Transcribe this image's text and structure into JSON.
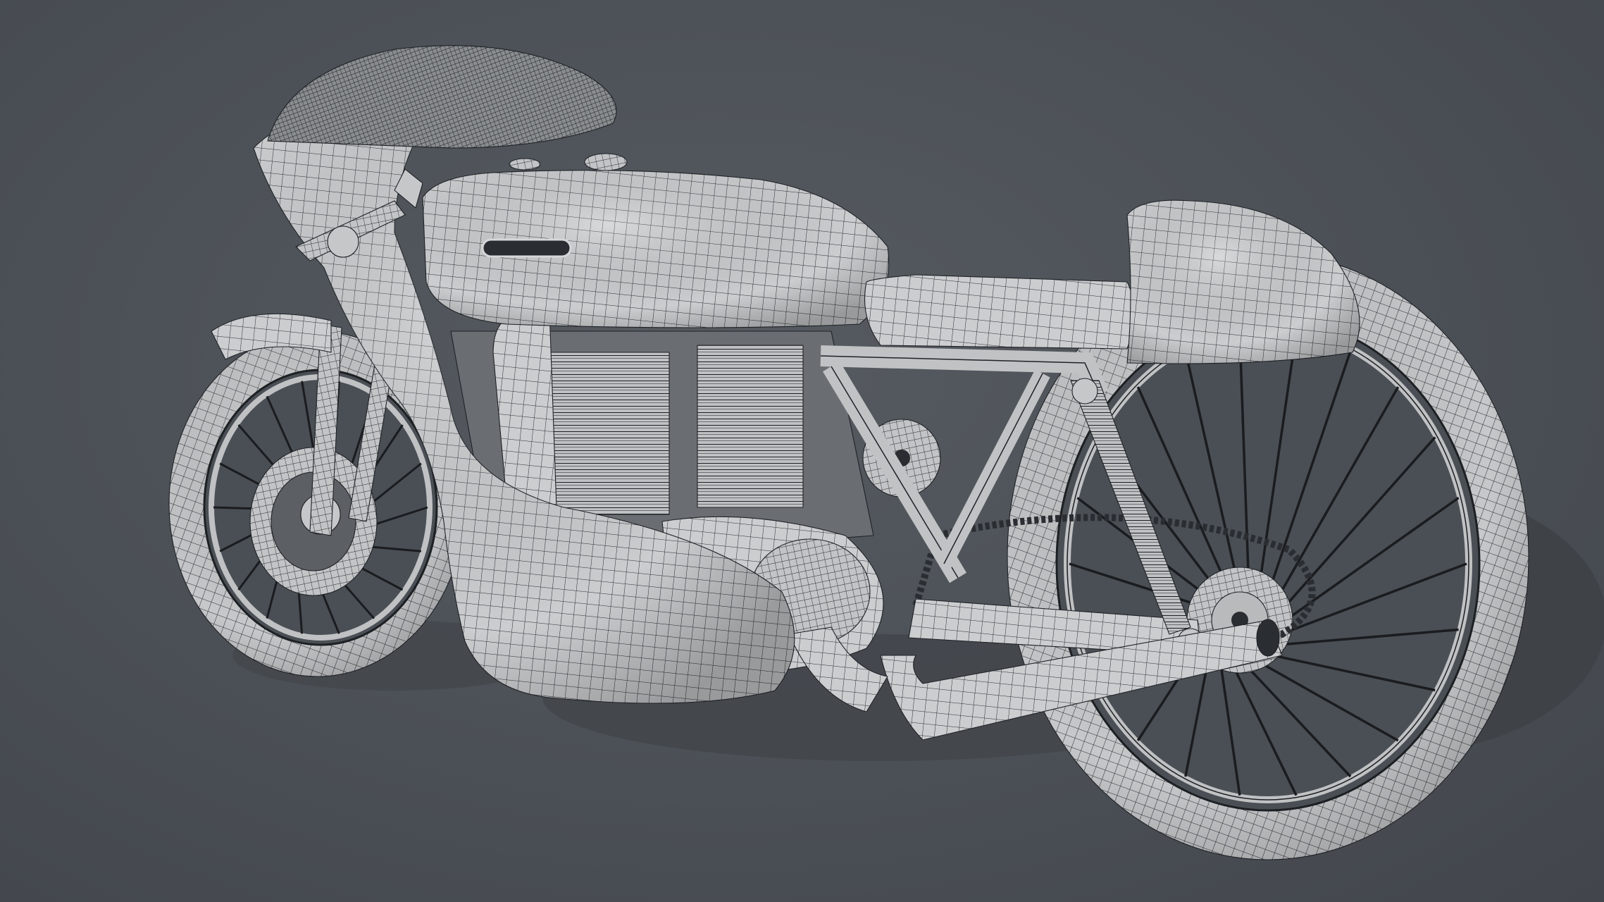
{
  "viewport": {
    "background_color": "#4a4f55",
    "content": "wireframe-motorcycle-model"
  },
  "model": {
    "surface_color": "#c9cbcd",
    "wire_color": "#1f2226",
    "shadow_color": "#3d4146",
    "front_wheel_spokes": 18,
    "rear_wheel_spokes": 22
  }
}
